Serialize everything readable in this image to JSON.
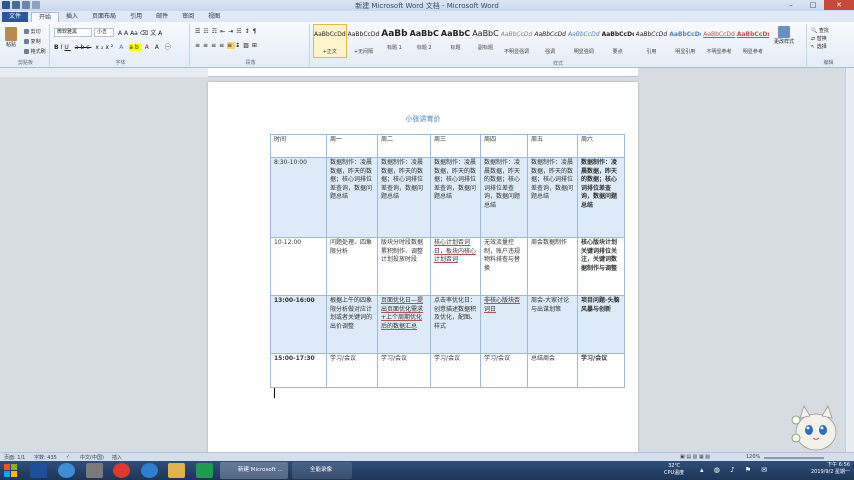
{
  "window": {
    "title": "新建 Microsoft Word 文档 - Microsoft Word"
  },
  "tabs": [
    "文件",
    "开始",
    "插入",
    "页面布局",
    "引用",
    "邮件",
    "审阅",
    "视图"
  ],
  "ribbon": {
    "clipboard": {
      "paste": "粘贴",
      "cut": "剪切",
      "copy": "复制",
      "format_painter": "格式刷",
      "label": "剪贴板"
    },
    "font": {
      "name": "微软雅黑",
      "size": "小五",
      "label": "字体"
    },
    "paragraph": {
      "label": "段落"
    },
    "styles": {
      "label": "样式",
      "items": [
        {
          "sample": "AaBbCcDd",
          "name": "+正文"
        },
        {
          "sample": "AaBbCcDd",
          "name": "+无间隔"
        },
        {
          "sample": "AaBb",
          "name": "标题 1"
        },
        {
          "sample": "AaBbC",
          "name": "标题 2"
        },
        {
          "sample": "AaBbC",
          "name": "标题"
        },
        {
          "sample": "AaBbC",
          "name": "副标题"
        },
        {
          "sample": "AaBbCcDd",
          "name": "不明显强调"
        },
        {
          "sample": "AaBbCcDd",
          "name": "强调"
        },
        {
          "sample": "AaBbCcDd",
          "name": "明显强调"
        },
        {
          "sample": "AaBbCcDd",
          "name": "要点"
        },
        {
          "sample": "AaBbCcDd",
          "name": "引用"
        },
        {
          "sample": "AaBbCcDd",
          "name": "明显引用"
        },
        {
          "sample": "AaBbCcDd",
          "name": "不明显参考"
        },
        {
          "sample": "AaBbCcDd",
          "name": "明显参考"
        }
      ],
      "change_styles": "更改样式"
    },
    "editing": {
      "find": "查找",
      "replace": "替换",
      "select": "选择",
      "label": "编辑"
    }
  },
  "document": {
    "title": "小张讲育价",
    "headers": [
      "时间",
      "周一",
      "周二",
      "周三",
      "周四",
      "周五",
      "周六"
    ],
    "rows": [
      {
        "time": "8:30-10:00",
        "cells": [
          "数据制作：凌晨数据，昨天的数据；核心词排位差查询，数据问题总结",
          "数据制作：凌晨数据，昨天的数据；核心词排位差查询，数据问题总结",
          "数据制作：凌晨数据，昨天的数据；核心词排位差查询，数据问题总结",
          "数据制作：凌晨数据，昨天的数据；核心词排位差查询，数据问题总结",
          "数据制作：凌晨数据，昨天的数据；核心词排位差查询，数据问题总结",
          "数据制作：凌晨数据，昨天的数据；核心词排位差查询，数据问题总结"
        ]
      },
      {
        "time": "10-12:00",
        "cells": [
          "问题处理、四象限分析",
          "版块分时段数据累积制作、调整计划投放时段",
          "核心计划否词日，板块内核心计划否词",
          "无效流量控制，账户违规物料排查与替换",
          "周会数据制作",
          "核心版块计划关键词排位关注，关键词数据制作与调整"
        ]
      },
      {
        "time": "13:00-16:00",
        "cells": [
          "根据上午的四象限分析做对应计划或者关键词的出价调整",
          "页面优化日—提出页面优化需求+上个周期优化后的数据汇总",
          "点击率优化日：创意描述数据积及优化，配图、样式",
          "非核心版块否词日",
          "周会-大家讨论与出谋划策",
          "项目问题-头脑风暴与创新"
        ]
      },
      {
        "time": "15:00-17:30",
        "cells": [
          "学习/会议",
          "学习/会议",
          "学习/会议",
          "学习/会议",
          "总结周会",
          "学习/会议"
        ]
      }
    ]
  },
  "status": {
    "page": "页面: 1/1",
    "words": "字数: 435",
    "lang": "中文(中国)",
    "mode": "插入",
    "zoom": "120%"
  },
  "taskbar": {
    "task1": "新建 Microsoft ...",
    "task2": "全能录像",
    "temp": "32℃",
    "cpu": "CPU温度",
    "time": "下午 6:56",
    "date": "2019/9/2 星期一"
  }
}
